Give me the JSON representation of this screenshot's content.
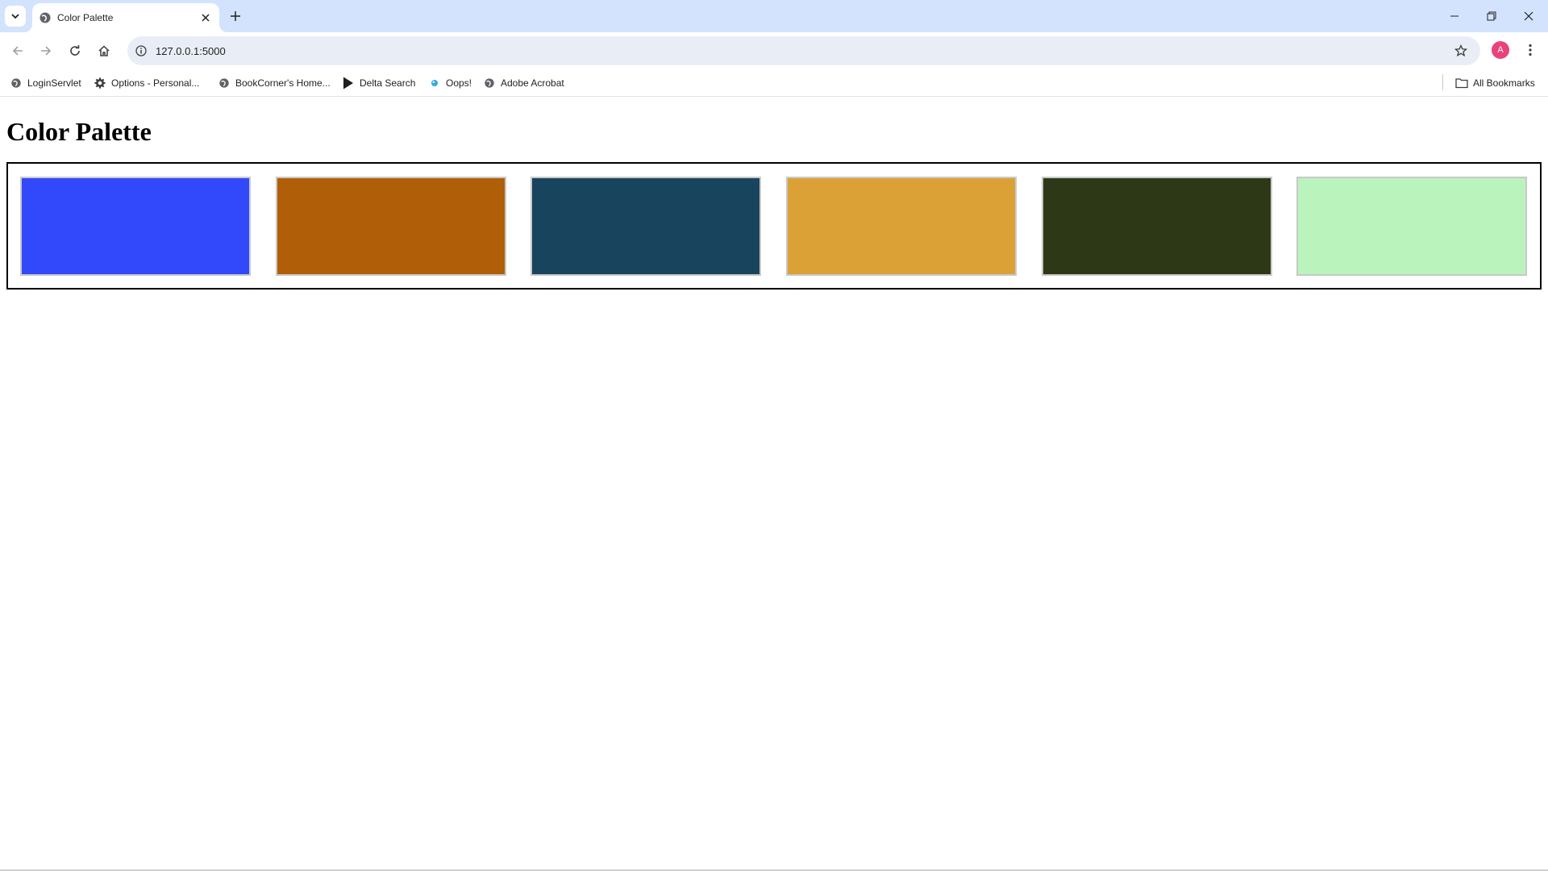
{
  "browser": {
    "tab": {
      "title": "Color Palette",
      "favicon": "globe-icon"
    },
    "new_tab_icon": "plus-icon",
    "url": "127.0.0.1:5000",
    "profile_initial": "A",
    "accent_color": "#e8437a",
    "bookmarks": [
      {
        "label": "LoginServlet",
        "icon": "globe-icon"
      },
      {
        "label": "Options - Personal...",
        "icon": "gear-icon"
      },
      {
        "label": "BookCorner's Home...",
        "icon": "globe-icon"
      },
      {
        "label": "Delta Search",
        "icon": "play-icon"
      },
      {
        "label": "Oops!",
        "icon": "drop-icon"
      },
      {
        "label": "Adobe Acrobat",
        "icon": "globe-icon"
      }
    ],
    "all_bookmarks_label": "All Bookmarks"
  },
  "page": {
    "title": "Color Palette",
    "swatches": [
      {
        "color": "#3149fb"
      },
      {
        "color": "#b05f08"
      },
      {
        "color": "#18455d"
      },
      {
        "color": "#dba137"
      },
      {
        "color": "#2d3916"
      },
      {
        "color": "#bbf3bc"
      }
    ]
  }
}
